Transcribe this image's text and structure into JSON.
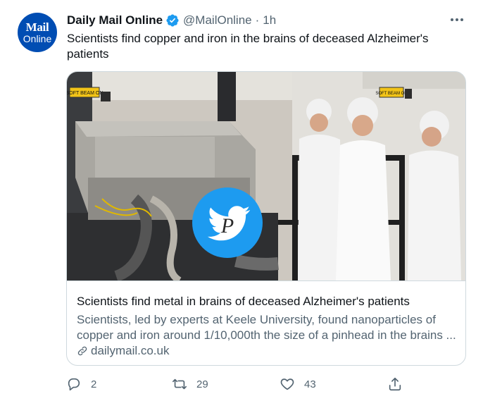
{
  "account": {
    "name": "Daily Mail Online",
    "handle": "@MailOnline",
    "separator": "·",
    "time": "1h",
    "avatar_line1": "Mail",
    "avatar_line2": "Online"
  },
  "tweet_text": "Scientists find copper and iron in the brains of deceased Alzheimer's patients",
  "card": {
    "title": "Scientists find metal in brains of deceased Alzheimer's patients",
    "description": "Scientists, led by experts at Keele University, found nanoparticles of copper and iron around 1/10,000th the size of a pinhead in the brains ...",
    "domain": "dailymail.co.uk",
    "sign_text": "SOFT BEAM ON"
  },
  "actions": {
    "replies": "2",
    "retweets": "29",
    "likes": "43"
  },
  "icons": {
    "verified": "verified-badge-icon",
    "more": "more-icon",
    "link": "link-icon",
    "reply": "reply-icon",
    "retweet": "retweet-icon",
    "like": "like-icon",
    "share": "share-icon",
    "watermark": "bird-watermark-icon"
  },
  "colors": {
    "verified_blue": "#1d9bf0",
    "secondary_text": "#536471",
    "avatar_blue": "#004db3"
  }
}
